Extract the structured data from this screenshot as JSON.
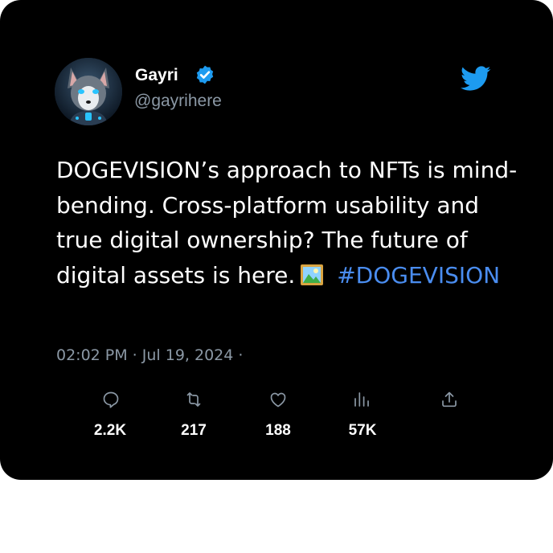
{
  "user": {
    "display_name": "Gayri",
    "handle": "@gayrihere",
    "avatar_icon": "husky-dog-avatar-icon",
    "verified_icon": "verified-badge-icon"
  },
  "brand": {
    "logo_icon": "twitter-bird-icon",
    "accent_color": "#1d9bf0",
    "hashtag_color": "#4a8df0"
  },
  "tweet": {
    "text": "DOGEVISION’s approach to NFTs is mind-bending. Cross-platform usability and true digital ownership? The future of digital assets is here.",
    "emoji_icon": "framed-picture-emoji",
    "hashtag": "#DOGEVISION",
    "timestamp": "02:02 PM · Jul 19, 2024 ·"
  },
  "stats": {
    "replies": {
      "icon": "reply-icon",
      "count": "2.2K"
    },
    "retweets": {
      "icon": "retweet-icon",
      "count": "217"
    },
    "likes": {
      "icon": "heart-icon",
      "count": "188"
    },
    "views": {
      "icon": "views-icon",
      "count": "57K"
    },
    "share": {
      "icon": "share-icon"
    }
  }
}
